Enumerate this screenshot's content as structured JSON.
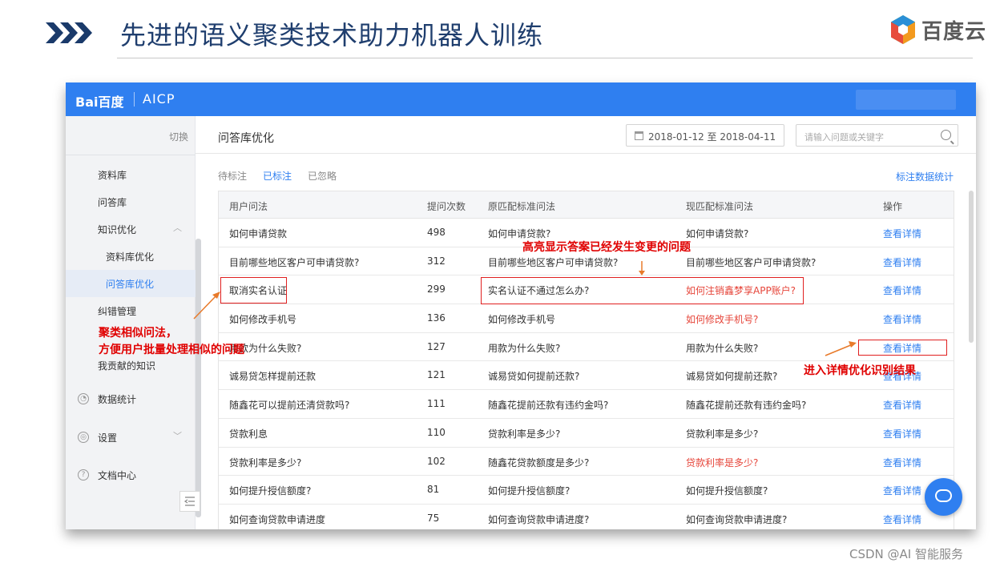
{
  "slide": {
    "title": "先进的语义聚类技术助力机器人训练",
    "logo_text": "百度云",
    "watermark": "CSDN @AI 智能服务"
  },
  "app": {
    "brand": "Bai百度",
    "brand_sub": "AICP"
  },
  "sidebar": {
    "switch_label": "切换",
    "items": [
      {
        "label": "资料库"
      },
      {
        "label": "问答库"
      },
      {
        "label": "知识优化"
      },
      {
        "label": "资料库优化"
      },
      {
        "label": "问答库优化"
      },
      {
        "label": "纠错管理"
      },
      {
        "label": "我贡献的知识"
      },
      {
        "label": "数据统计"
      },
      {
        "label": "设置"
      },
      {
        "label": "文档中心"
      }
    ]
  },
  "main": {
    "title": "问答库优化",
    "date_range": "2018-01-12  至  2018-04-11",
    "search_placeholder": "请输入问题或关键字",
    "tabs": [
      {
        "label": "待标注"
      },
      {
        "label": "已标注"
      },
      {
        "label": "已忽略"
      }
    ],
    "stats_link": "标注数据统计"
  },
  "table": {
    "headers": [
      "用户问法",
      "提问次数",
      "原匹配标准问法",
      "现匹配标准问法",
      "操作"
    ],
    "action_label": "查看详情",
    "rows": [
      {
        "q": "如何申请贷款",
        "count": "498",
        "orig": "如何申请贷款?",
        "curr": "如何申请贷款?",
        "changed": false
      },
      {
        "q": "目前哪些地区客户可申请贷款?",
        "count": "312",
        "orig": "目前哪些地区客户可申请贷款?",
        "curr": "目前哪些地区客户可申请贷款?",
        "changed": false
      },
      {
        "q": "取消实名认证",
        "count": "299",
        "orig": "实名认证不通过怎么办?",
        "curr": "如何注销鑫梦享APP账户?",
        "changed": true
      },
      {
        "q": "如何修改手机号",
        "count": "136",
        "orig": "如何修改手机号",
        "curr": "如何修改手机号?",
        "changed": true
      },
      {
        "q": "用款为什么失败?",
        "count": "127",
        "orig": "用款为什么失败?",
        "curr": "用款为什么失败?",
        "changed": false
      },
      {
        "q": "诚易贷怎样提前还款",
        "count": "121",
        "orig": "诚易贷如何提前还款?",
        "curr": "诚易贷如何提前还款?",
        "changed": false
      },
      {
        "q": "随鑫花可以提前还清贷款吗?",
        "count": "111",
        "orig": "随鑫花提前还款有违约金吗?",
        "curr": "随鑫花提前还款有违约金吗?",
        "changed": false
      },
      {
        "q": "贷款利息",
        "count": "110",
        "orig": "贷款利率是多少?",
        "curr": "贷款利率是多少?",
        "changed": false
      },
      {
        "q": "贷款利率是多少?",
        "count": "102",
        "orig": "随鑫花贷款额度是多少?",
        "curr": "贷款利率是多少?",
        "changed": true
      },
      {
        "q": "如何提升授信额度?",
        "count": "81",
        "orig": "如何提升授信额度?",
        "curr": "如何提升授信额度?",
        "changed": false
      },
      {
        "q": "如何查询贷款申请进度",
        "count": "75",
        "orig": "如何查询贷款申请进度?",
        "curr": "如何查询贷款申请进度?",
        "changed": false
      }
    ]
  },
  "annotations": {
    "highlight": "高亮显示答案已经发生变更的问题",
    "cluster_line1": "聚类相似问法，",
    "cluster_line2": "方便用户批量处理相似的问题",
    "detail": "进入详情优化识别结果"
  },
  "colors": {
    "brand_blue": "#2f7ff0",
    "changed_red": "#e6453a",
    "annotation_red": "#e00000",
    "title_navy": "#1f3e6e"
  }
}
